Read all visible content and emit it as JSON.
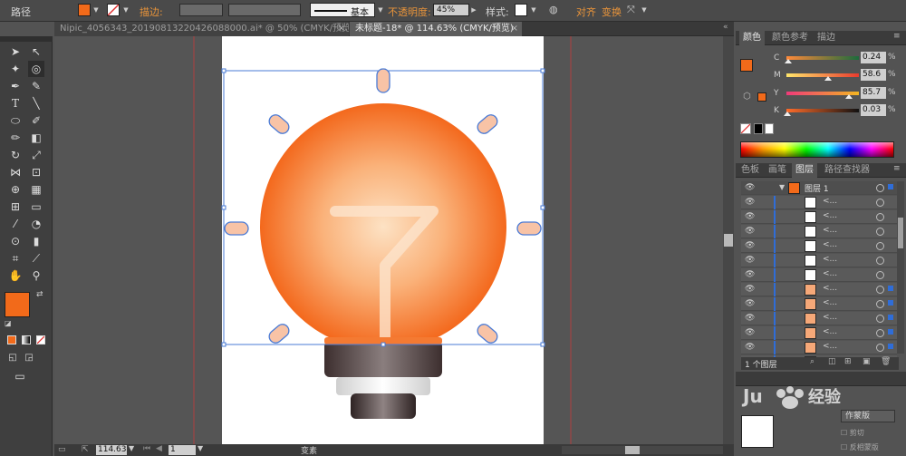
{
  "control_bar": {
    "object_type": "路径",
    "stroke_label": "描边",
    "stroke_style": "基本",
    "opacity_label": "不透明度",
    "opacity_value": "45%",
    "style_label": "样式",
    "align_label": "对齐",
    "transform_label": "变换",
    "fill_color": "#f26a1a"
  },
  "tabs": [
    {
      "label": "Nipic_4056343_20190813220426088000.ai* @ 50% (CMYK/预览)",
      "active": false
    },
    {
      "label": "未标题-18* @ 114.63% (CMYK/预览)",
      "active": true
    }
  ],
  "color_panel": {
    "tabs": [
      "颜色",
      "颜色参考",
      "描边"
    ],
    "channels": [
      {
        "name": "C",
        "value": "0.24",
        "gradient": "linear-gradient(90deg,#ff8a3a,#1c6b3c)",
        "knob": 0.02
      },
      {
        "name": "M",
        "value": "58.6",
        "gradient": "linear-gradient(90deg,#ffe56b,#e83b2e)",
        "knob": 0.58
      },
      {
        "name": "Y",
        "value": "85.7",
        "gradient": "linear-gradient(90deg,#ef3a7a,#f3b521)",
        "knob": 0.86
      },
      {
        "name": "K",
        "value": "0.03",
        "gradient": "linear-gradient(90deg,#ff6c2a,#111111)",
        "knob": 0.01
      }
    ],
    "percent": "%"
  },
  "layers_panel": {
    "tabs": [
      "色板",
      "画笔",
      "图层",
      "路径查找器"
    ],
    "top_layer_name": "图层 1",
    "sublayer_label": "<...",
    "sublayer_count": 12,
    "footer_text": "1 个图层"
  },
  "overlay_panel": {
    "label1": "作蒙版",
    "label2": "剪切",
    "label3": "反相蒙版"
  },
  "status_bar": {
    "zoom": "114.63",
    "page": "1",
    "tool": "变素"
  },
  "colors": {
    "accent": "#f26a1a",
    "bulb_center": "#fde2c4",
    "bulb_edge": "#f25a0a",
    "ray": "#f8c3a6"
  }
}
